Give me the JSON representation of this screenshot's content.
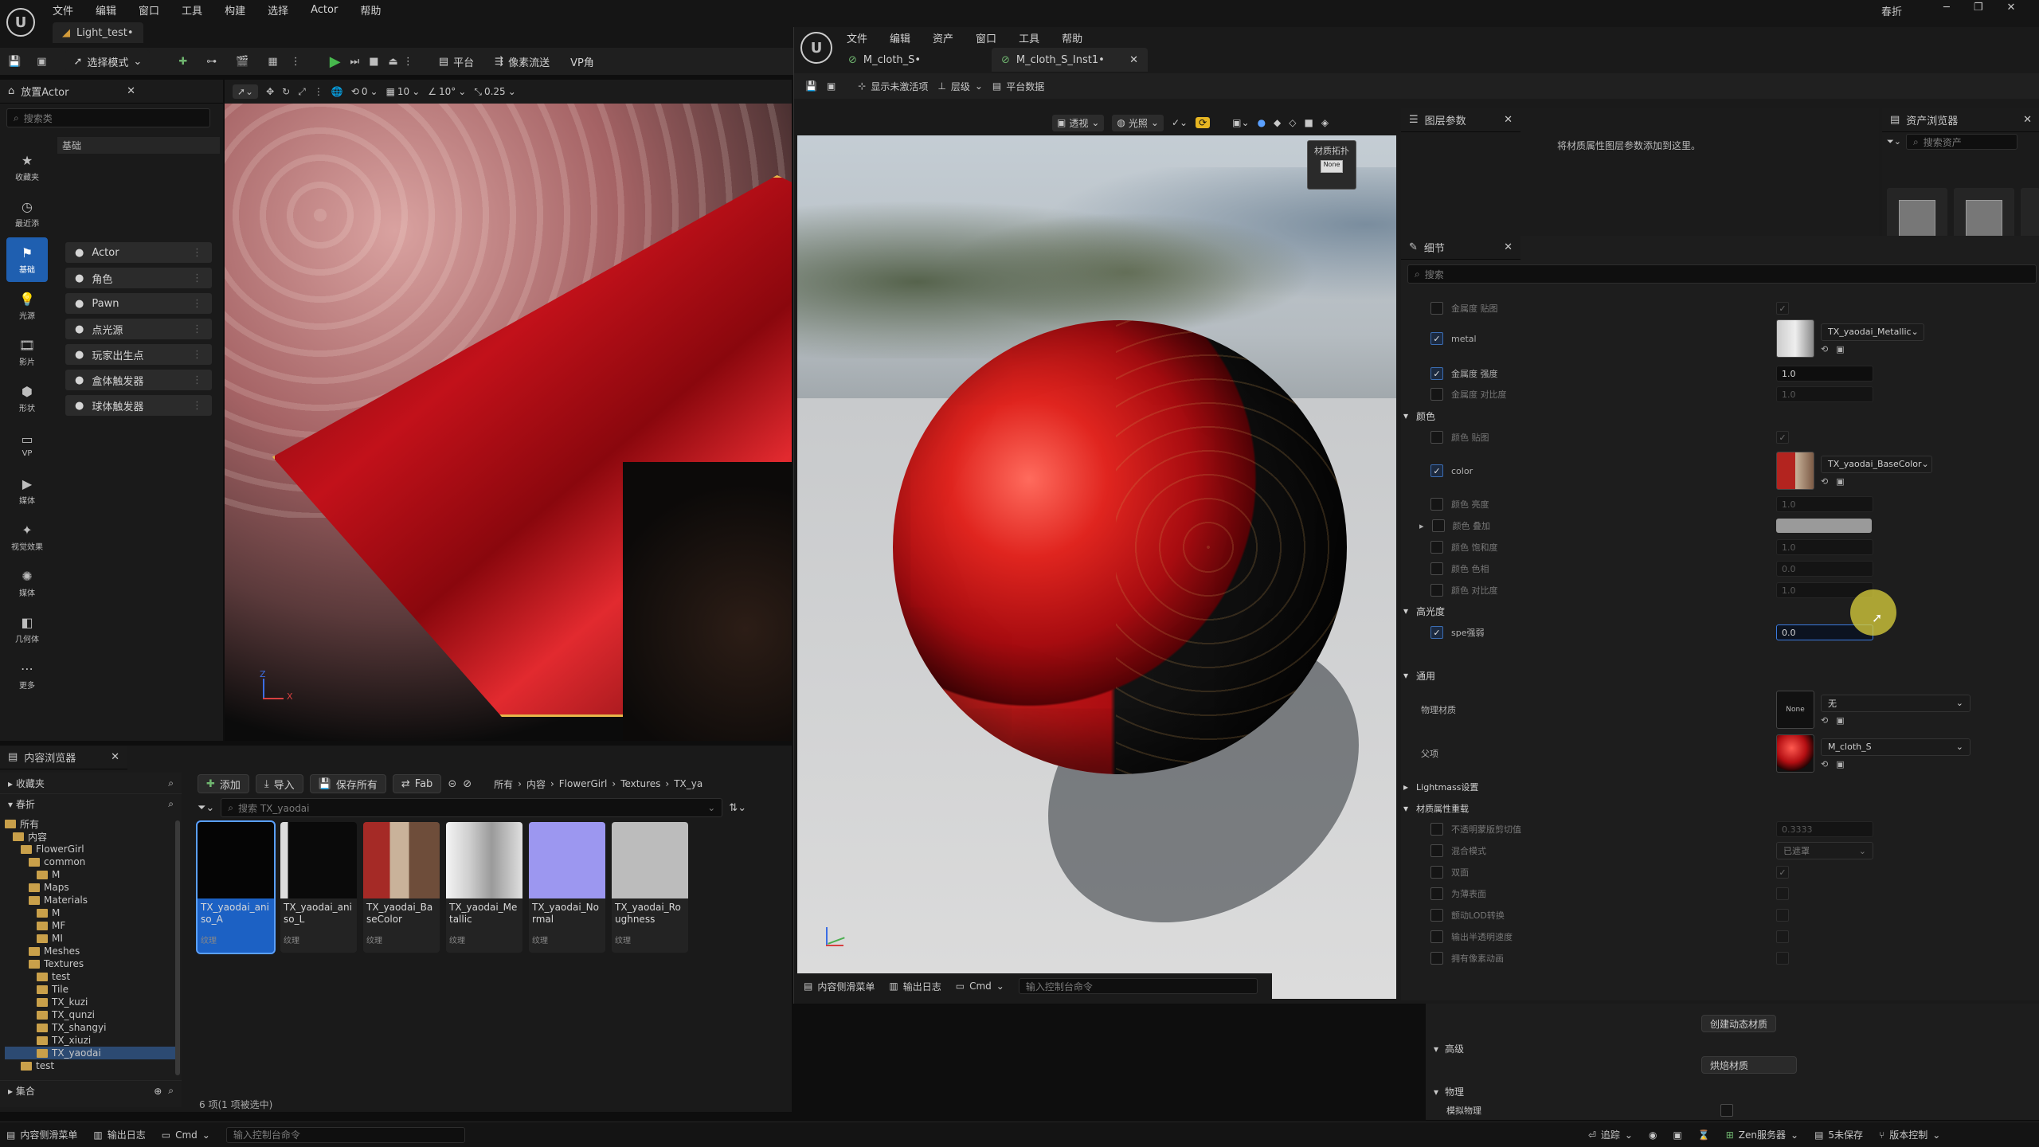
{
  "main_menu": [
    "文件",
    "编辑",
    "窗口",
    "工具",
    "构建",
    "选择",
    "Actor",
    "帮助"
  ],
  "project_name": "春折",
  "level_tab": "Light_test•",
  "main_toolbar": {
    "select_mode": "选择模式",
    "platform": "平台",
    "pixel_stream": "像素流送",
    "vp": "VP角"
  },
  "viewport_toolbar": {
    "snap_grid": "10",
    "snap_angle": "10°",
    "snap_scale": "0.25",
    "rotate_val": "0"
  },
  "place_actor": {
    "title": "放置Actor",
    "search_placeholder": "搜索类",
    "section": "基础",
    "categories": [
      "收藏夹",
      "最近添",
      "基础",
      "光源",
      "影片",
      "形状",
      "VP",
      "媒体",
      "视觉效果",
      "媒体",
      "几何体",
      "更多"
    ],
    "items": [
      "Actor",
      "角色",
      "Pawn",
      "点光源",
      "玩家出生点",
      "盒体触发器",
      "球体触发器"
    ]
  },
  "content_browser": {
    "title": "内容浏览器",
    "favorites": "收藏夹",
    "project": "春折",
    "buttons": {
      "add": "添加",
      "import": "导入",
      "save_all": "保存所有",
      "fab": "Fab"
    },
    "breadcrumb": [
      "所有",
      "内容",
      "FlowerGirl",
      "Textures",
      "TX_ya"
    ],
    "search_placeholder": "搜索 TX_yaodai",
    "tree": [
      {
        "label": "所有",
        "depth": 0
      },
      {
        "label": "内容",
        "depth": 1
      },
      {
        "label": "FlowerGirl",
        "depth": 2
      },
      {
        "label": "common",
        "depth": 3
      },
      {
        "label": "M",
        "depth": 4
      },
      {
        "label": "Maps",
        "depth": 3
      },
      {
        "label": "Materials",
        "depth": 3
      },
      {
        "label": "M",
        "depth": 4
      },
      {
        "label": "MF",
        "depth": 4
      },
      {
        "label": "MI",
        "depth": 4
      },
      {
        "label": "Meshes",
        "depth": 3
      },
      {
        "label": "Textures",
        "depth": 3
      },
      {
        "label": "test",
        "depth": 4
      },
      {
        "label": "Tile",
        "depth": 4
      },
      {
        "label": "TX_kuzi",
        "depth": 4
      },
      {
        "label": "TX_qunzi",
        "depth": 4
      },
      {
        "label": "TX_shangyi",
        "depth": 4
      },
      {
        "label": "TX_xiuzi",
        "depth": 4
      },
      {
        "label": "TX_yaodai",
        "depth": 4
      },
      {
        "label": "test",
        "depth": 2
      }
    ],
    "collections": "集合",
    "status": "6 项(1 项被选中)",
    "assets": [
      {
        "name": "TX_yaodai_aniso_A",
        "type": "纹理",
        "color": "#050505"
      },
      {
        "name": "TX_yaodai_aniso_L",
        "type": "纹理",
        "color": "#0a0a0a"
      },
      {
        "name": "TX_yaodai_BaseColor",
        "type": "纹理",
        "color": "#9b2a28"
      },
      {
        "name": "TX_yaodai_Metallic",
        "type": "纹理",
        "color": "#c8c8c8"
      },
      {
        "name": "TX_yaodai_Normal",
        "type": "纹理",
        "color": "#9c97f0"
      },
      {
        "name": "TX_yaodai_Roughness",
        "type": "纹理",
        "color": "#bcbcbc"
      }
    ]
  },
  "bottom_bar": {
    "drawer": "内容侧滑菜单",
    "output": "输出日志",
    "cmd": "Cmd",
    "cmd_placeholder": "输入控制台命令",
    "trace": "追踪",
    "zen": "Zen服务器",
    "unsaved": "5未保存",
    "version": "版本控制"
  },
  "material_editor": {
    "menu": [
      "文件",
      "编辑",
      "资产",
      "窗口",
      "工具",
      "帮助"
    ],
    "tabs": [
      "M_cloth_S•",
      "M_cloth_S_Inst1•"
    ],
    "toolbar": {
      "hierarchy_btn": "显示未激活项",
      "level": "层级",
      "platform": "平台数据"
    },
    "viewport": {
      "view_mode": "透视",
      "lighting": "光照",
      "preview_label": "材质拓扑",
      "preview_value": "None"
    },
    "layer_params": {
      "title": "图层参数",
      "message": "将材质属性图层参数添加到这里。"
    },
    "asset_browser": {
      "title": "资产浏览器",
      "search": "搜索资产"
    },
    "details": {
      "title": "细节",
      "search": "搜索",
      "rows": {
        "metal_map": "金属度 贴图",
        "metal": "metal",
        "metal_tex": "TX_yaodai_Metallic",
        "metal_strength": "金属度 强度",
        "metal_strength_val": "1.0",
        "metal_contrast": "金属度 对比度",
        "metal_contrast_val": "1.0",
        "color_cat": "颜色",
        "color_map": "颜色 贴图",
        "color": "color",
        "color_tex": "TX_yaodai_BaseColor",
        "color_brightness": "颜色 亮度",
        "color_brightness_val": "1.0",
        "color_overlay": "颜色 叠加",
        "color_saturation": "颜色 饱和度",
        "color_saturation_val": "1.0",
        "color_hue": "颜色 色相",
        "color_hue_val": "0.0",
        "color_contrast": "颜色 对比度",
        "color_contrast_val": "1.0",
        "spec_cat": "高光度",
        "spe": "spe强弱",
        "spe_val": "0.0",
        "general_cat": "通用",
        "phys_mat": "物理材质",
        "phys_none": "None",
        "phys_val": "无",
        "parent": "父项",
        "parent_val": "M_cloth_S",
        "lightmass": "Lightmass设置",
        "override_cat": "材质属性重载",
        "opacity_clip": "不透明蒙版剪切值",
        "opacity_clip_val": "0.3333",
        "blend_mode": "混合模式",
        "blend_val": "已遮罩",
        "two_sided": "双面",
        "thin": "为薄表面",
        "dither": "颤动LOD转换",
        "output_trans": "输出半透明速度",
        "pixel_anim": "拥有像素动画"
      }
    },
    "bottom": {
      "drawer": "内容侧滑菜单",
      "output": "输出日志",
      "cmd": "Cmd",
      "cmd_placeholder": "输入控制台命令"
    }
  },
  "under_panel": {
    "create_dynamic": "创建动态材质",
    "advanced": "高级",
    "bake": "烘焙材质",
    "physics": "物理",
    "simulate": "模拟物理"
  }
}
